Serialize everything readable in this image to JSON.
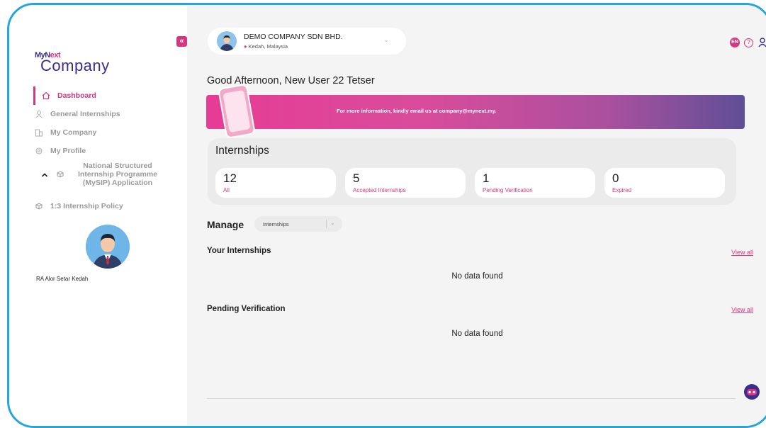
{
  "sidebar": {
    "logo": {
      "my": "MyN",
      "ext": "ext",
      "company": "Company"
    },
    "items": [
      {
        "label": "Dashboard",
        "icon": "home-icon",
        "active": true
      },
      {
        "label": "General Internships",
        "icon": "person-icon"
      },
      {
        "label": "My Company",
        "icon": "building-icon"
      },
      {
        "label": "My Profile",
        "icon": "gear-icon"
      },
      {
        "label": "National Structured Internship Programme (MySIP) Application",
        "icon": "cube-icon",
        "expandable": true
      },
      {
        "label": "1:3 Internship Policy",
        "icon": "cube-icon"
      }
    ],
    "user_name": "RA Alor Setar Kedah",
    "collapse_glyph": "«"
  },
  "header": {
    "company_name": "DEMO COMPANY SDN BHD.",
    "company_location": "Kedah, Malaysia",
    "language": "EN",
    "help": "?",
    "dropdown_glyph": "⌄"
  },
  "main": {
    "greeting": "Good Afternoon, New User 22 Tetser",
    "banner_text": "For more information, kindly email us at company@mynext.my.",
    "stats_title": "Internships",
    "stats": [
      {
        "value": "12",
        "label": "All"
      },
      {
        "value": "5",
        "label": "Accepted Internships"
      },
      {
        "value": "1",
        "label": "Pending Verification"
      },
      {
        "value": "0",
        "label": "Expired"
      }
    ],
    "manage_label": "Manage",
    "manage_select": "Internships",
    "sections": [
      {
        "title": "Your Internships",
        "view_all": "View all",
        "empty": "No data found"
      },
      {
        "title": "Pending Verification",
        "view_all": "View all",
        "empty": "No data found"
      }
    ]
  },
  "colors": {
    "accent": "#d8357f",
    "brand": "#3a2f8f",
    "frame": "#23a6e0"
  }
}
